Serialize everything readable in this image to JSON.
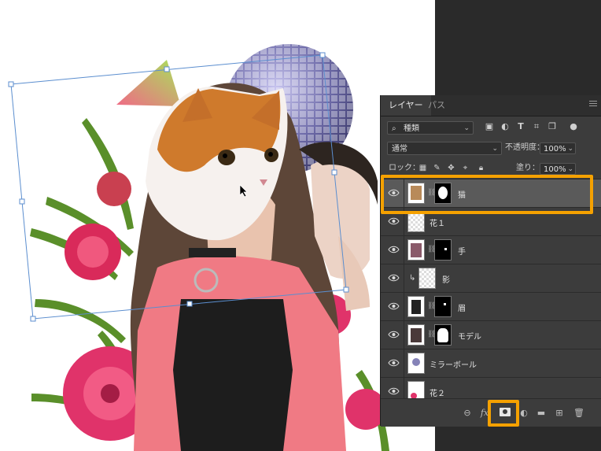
{
  "panel": {
    "tabs": [
      {
        "label": "レイヤー",
        "active": true
      },
      {
        "label": "パス",
        "active": false
      }
    ],
    "filter": {
      "kind": "種類"
    },
    "blend_mode": "通常",
    "opacity_label": "不透明度：",
    "opacity_value": "100%",
    "lock_label": "ロック：",
    "fill_label": "塗り：",
    "fill_value": "100%"
  },
  "layers": [
    {
      "name": "猫",
      "selected": true,
      "has_mask": true
    },
    {
      "name": "花１",
      "selected": false,
      "has_mask": false
    },
    {
      "name": "手",
      "selected": false,
      "has_mask": true
    },
    {
      "name": "影",
      "selected": false,
      "has_mask": false,
      "clipped": true
    },
    {
      "name": "眉",
      "selected": false,
      "has_mask": true
    },
    {
      "name": "モデル",
      "selected": false,
      "has_mask": true
    },
    {
      "name": "ミラーボール",
      "selected": false,
      "has_mask": false
    },
    {
      "name": "花２",
      "selected": false,
      "has_mask": false
    }
  ],
  "bottom_icons": [
    "link-icon",
    "fx-icon",
    "add-mask-icon",
    "adjustment-icon",
    "folder-icon",
    "new-layer-icon",
    "trash-icon"
  ],
  "colors": {
    "highlight": "#f5a100",
    "panel_bg": "#3c3c3c",
    "selected_row": "#5a5a5a",
    "transform_box": "#5b8ecf"
  }
}
